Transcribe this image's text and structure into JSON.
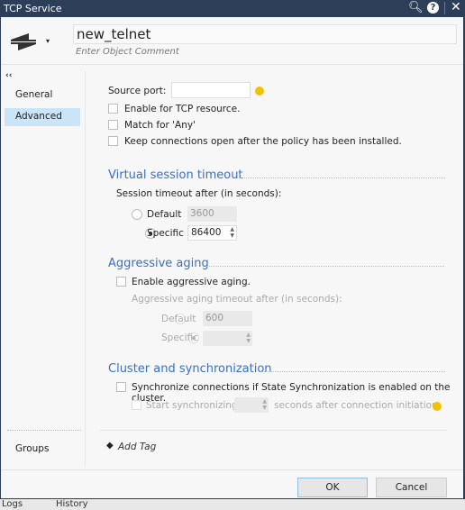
{
  "window": {
    "title": "TCP Service"
  },
  "header": {
    "name": "new_telnet",
    "comment_placeholder": "Enter Object Comment"
  },
  "sidebar": {
    "collapse": "‹‹",
    "items": [
      {
        "label": "General"
      },
      {
        "label": "Advanced",
        "selected": true
      }
    ],
    "groups": "Groups"
  },
  "main": {
    "source_port_label": "Source port:",
    "source_port_value": "",
    "enable_tcp": "Enable for TCP resource.",
    "match_any": "Match for 'Any'",
    "keep_open": "Keep connections open after the policy has been installed.",
    "vst": {
      "title": "Virtual session timeout",
      "label": "Session timeout after (in seconds):",
      "default_label": "Default",
      "default_value": "3600",
      "specific_label": "Specific",
      "specific_value": "86400",
      "selected": "Specific"
    },
    "aa": {
      "title": "Aggressive aging",
      "enable": "Enable aggressive aging.",
      "label": "Aggressive aging timeout after (in seconds):",
      "default_label": "Default",
      "default_value": "600",
      "specific_label": "Specific",
      "selected": "Specific"
    },
    "cs": {
      "title": "Cluster and synchronization",
      "sync": "Synchronize connections if State Synchronization is enabled on the cluster.",
      "start": "Start synchronizing",
      "after": "seconds after connection initiation."
    },
    "add_tag": "Add Tag"
  },
  "footer": {
    "ok": "OK",
    "cancel": "Cancel"
  },
  "bottom_tabs": [
    "Logs",
    "History"
  ],
  "colors": {
    "frame": "#2d3e58",
    "accent": "#3a6fc4",
    "selected": "#cce4f7",
    "hint": "#f2c200"
  }
}
